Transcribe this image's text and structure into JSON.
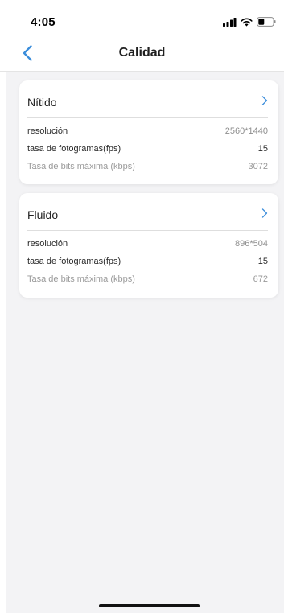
{
  "status_bar": {
    "time": "4:05"
  },
  "nav": {
    "title": "Calidad",
    "back_icon": "chevron-left-icon"
  },
  "colors": {
    "accent": "#3a8ddb",
    "page_background": "#f3f3f5",
    "card_background": "#ffffff"
  },
  "cards": [
    {
      "title": "Nítido",
      "chevron_icon": "chevron-right-icon",
      "rows": [
        {
          "label": "resolución",
          "value": "2560*1440"
        },
        {
          "label": "tasa de fotogramas(fps)",
          "value": "15"
        },
        {
          "label": "Tasa de bits máxima (kbps)",
          "value": "3072"
        }
      ]
    },
    {
      "title": "Fluido",
      "chevron_icon": "chevron-right-icon",
      "rows": [
        {
          "label": "resolución",
          "value": "896*504"
        },
        {
          "label": "tasa de fotogramas(fps)",
          "value": "15"
        },
        {
          "label": "Tasa de bits máxima (kbps)",
          "value": "672"
        }
      ]
    }
  ]
}
